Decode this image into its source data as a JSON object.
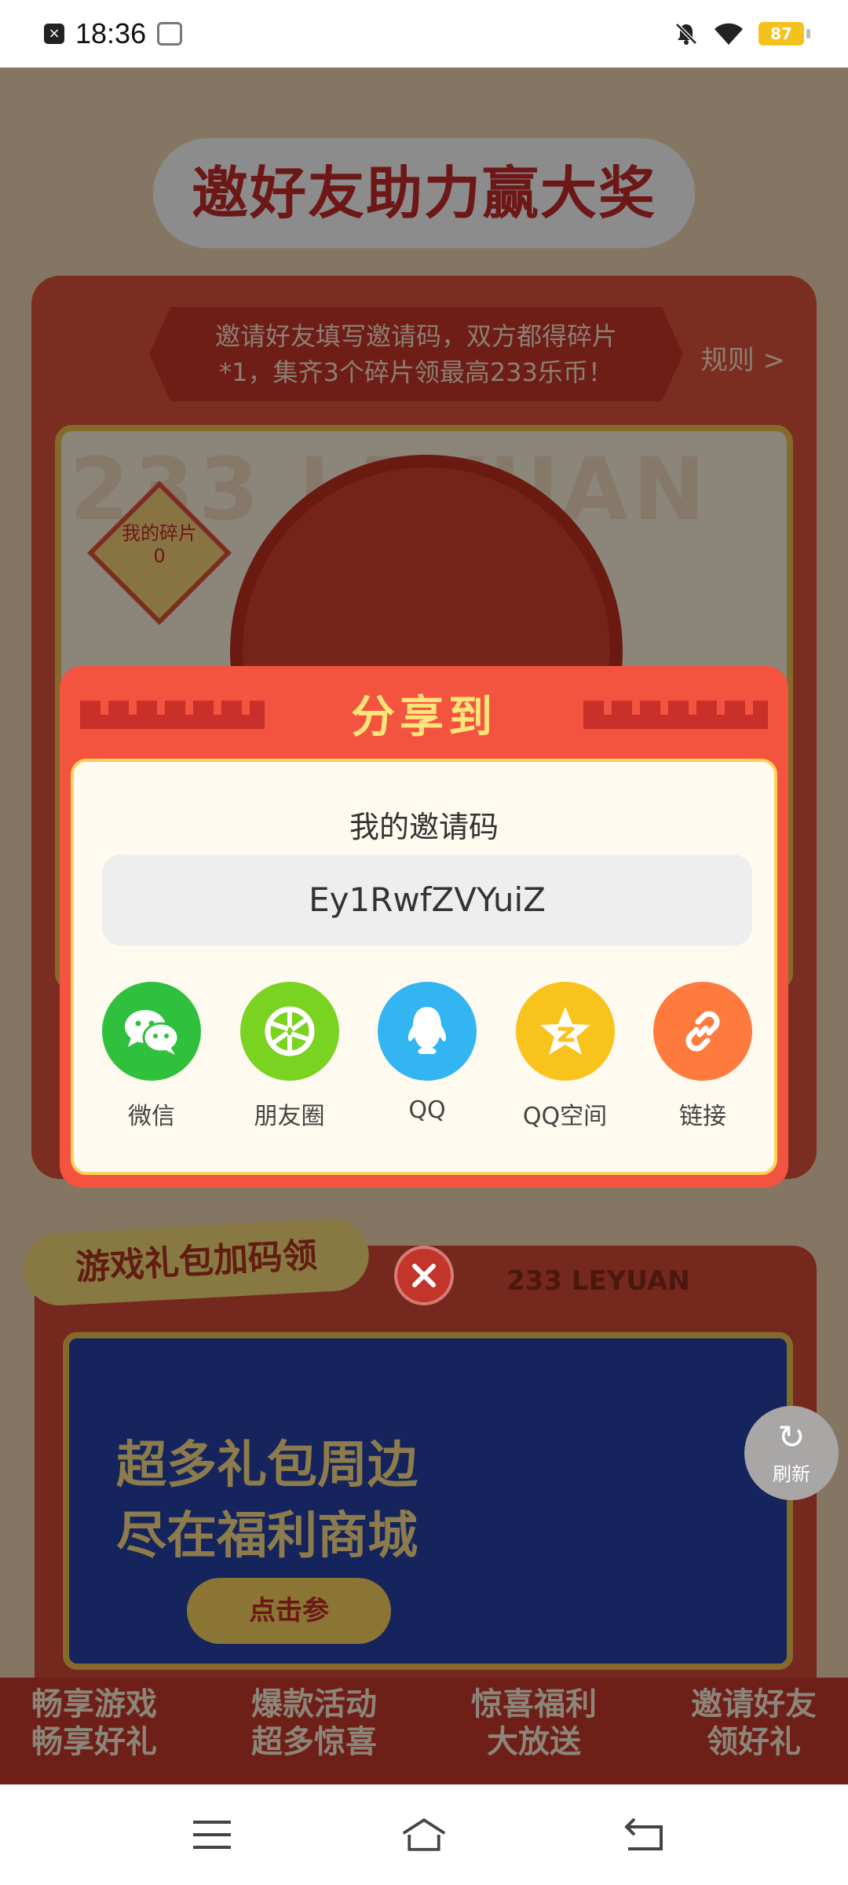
{
  "status_bar": {
    "time": "18:36",
    "battery": "87"
  },
  "page": {
    "hero_title": "邀好友助力赢大奖",
    "invite_notice_line1": "邀请好友填写邀请码，双方都得碎片",
    "invite_notice_line2": "*1，集齐3个碎片领最高233乐币！",
    "rules_link": "规则 >",
    "wheel_bg_text": "233 LEYUAN",
    "my_pieces_label": "我的碎片",
    "my_pieces_count": "0",
    "gift_tag": "游戏礼包加码领",
    "leyuan_text": "233 LEYUAN",
    "banner_line1": "超多礼包周边",
    "banner_line2": "尽在福利商城",
    "banner_button": "点击参",
    "features": [
      {
        "line1": "畅享游戏",
        "line2": "畅享好礼"
      },
      {
        "line1": "爆款活动",
        "line2": "超多惊喜"
      },
      {
        "line1": "惊喜福利",
        "line2": "大放送"
      },
      {
        "line1": "邀请好友",
        "line2": "领好礼"
      }
    ],
    "refresh_label": "刷新"
  },
  "modal": {
    "title": "分享到",
    "code_label": "我的邀请码",
    "invite_code": "Ey1RwfZVYuiZ",
    "share_targets": [
      {
        "label": "微信",
        "icon": "wechat-icon",
        "color": "#2fc13e"
      },
      {
        "label": "朋友圈",
        "icon": "moments-icon",
        "color": "#7ad320"
      },
      {
        "label": "QQ",
        "icon": "qq-icon",
        "color": "#32b5f0"
      },
      {
        "label": "QQ空间",
        "icon": "qzone-icon",
        "color": "#f9c31e"
      },
      {
        "label": "链接",
        "icon": "link-icon",
        "color": "#ff7a3d"
      }
    ]
  },
  "colors": {
    "modal_bg": "#f2543f",
    "modal_title": "#ffe47a",
    "inner_bg": "#fffaf0",
    "accent_red": "#c9302a"
  }
}
